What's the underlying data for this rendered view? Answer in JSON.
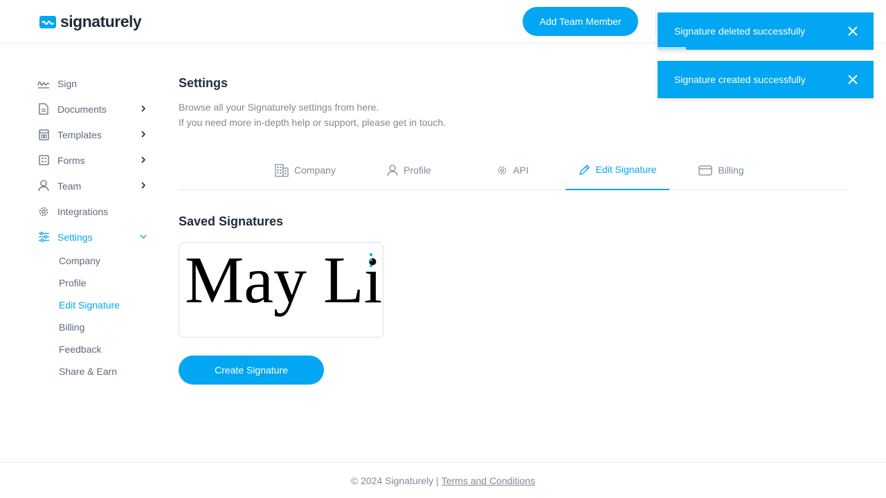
{
  "brand": {
    "name": "signaturely",
    "accent": "#02a6f2"
  },
  "header": {
    "add_member_label": "Add Team Member"
  },
  "sidebar": {
    "items": [
      {
        "label": "Sign",
        "icon": "signature-icon",
        "has_chevron": false
      },
      {
        "label": "Documents",
        "icon": "document-icon",
        "has_chevron": true
      },
      {
        "label": "Templates",
        "icon": "template-icon",
        "has_chevron": true
      },
      {
        "label": "Forms",
        "icon": "form-icon",
        "has_chevron": true
      },
      {
        "label": "Team",
        "icon": "user-icon",
        "has_chevron": true
      },
      {
        "label": "Integrations",
        "icon": "gear-icon",
        "has_chevron": false
      },
      {
        "label": "Settings",
        "icon": "sliders-icon",
        "has_chevron": true,
        "expanded": true,
        "active": true
      }
    ],
    "sub_items": [
      {
        "label": "Company"
      },
      {
        "label": "Profile"
      },
      {
        "label": "Edit Signature",
        "active": true
      },
      {
        "label": "Billing"
      },
      {
        "label": "Feedback"
      },
      {
        "label": "Share & Earn"
      }
    ]
  },
  "main": {
    "title": "Settings",
    "desc_line1": "Browse all your Signaturely settings from here.",
    "desc_line2": "If you need more in-depth help or support, please get in touch.",
    "tabs": [
      {
        "label": "Company",
        "icon": "building-icon"
      },
      {
        "label": "Profile",
        "icon": "user-icon"
      },
      {
        "label": "API",
        "icon": "gear-icon"
      },
      {
        "label": "Edit Signature",
        "icon": "pencil-icon",
        "active": true
      },
      {
        "label": "Billing",
        "icon": "card-icon"
      }
    ],
    "section_title": "Saved Signatures",
    "signature_text": "May Li",
    "create_label": "Create Signature"
  },
  "toasts": [
    {
      "message": "Signature deleted successfully",
      "progress": 0.13
    },
    {
      "message": "Signature created successfully",
      "progress": 0
    }
  ],
  "footer": {
    "copyright": "© 2024 Signaturely |",
    "terms_label": "Terms and Conditions"
  }
}
